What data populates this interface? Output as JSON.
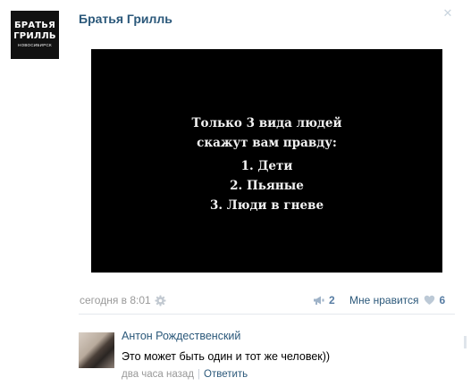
{
  "group": {
    "avatar_line1": "БРАТЬЯ",
    "avatar_line2": "ГРИЛЛЬ",
    "avatar_line3": "НОВОСИБИРСК",
    "name": "Братья Грилль"
  },
  "close_label": "✕",
  "image": {
    "title_line1": "Только 3 вида людей",
    "title_line2": "скажут вам правду:",
    "items": [
      "1. Дети",
      "2. Пьяные",
      "3. Люди в гневе"
    ]
  },
  "post": {
    "date": "сегодня в 8:01",
    "share_count": "2",
    "like_label": "Мне нравится",
    "like_count": "6"
  },
  "comment": {
    "author": "Антон Рождественский",
    "text": "Это может быть один и тот же человек))",
    "time": "два часа назад",
    "separator": "|",
    "reply_label": "Ответить"
  },
  "colors": {
    "link": "#2b587a",
    "accent": "#577ca3",
    "muted": "#999999",
    "icon": "#c2c9d1"
  },
  "icons": [
    "close-icon",
    "gear-icon",
    "megaphone-icon",
    "heart-icon"
  ]
}
